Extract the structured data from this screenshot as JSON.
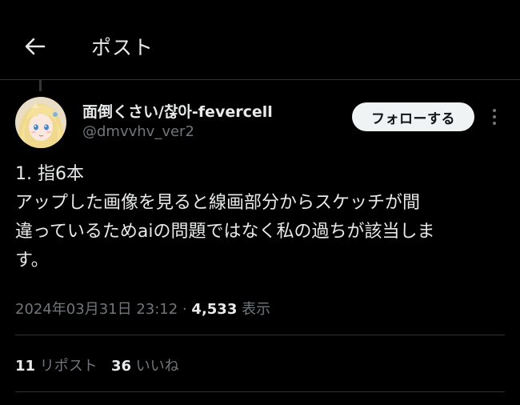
{
  "header": {
    "title": "ポスト",
    "back_icon": "arrow-left-icon"
  },
  "author": {
    "display_name": "面倒くさい/찮아-fevercell",
    "handle": "@dmvvhv_ver2",
    "avatar_icon": "avatar-anime-girl"
  },
  "follow_button": {
    "label": "フォローする"
  },
  "more_icon": "more-vertical-icon",
  "tweet": {
    "lines": [
      "1. 指6本",
      "アップした画像を見ると線画部分からスケッチが間",
      "違っているためaiの問題ではなく私の過ちが該当しま",
      "す。"
    ]
  },
  "meta": {
    "timestamp": "2024年03月31日 23:12",
    "separator": "·",
    "views_count": "4,533",
    "views_label": "表示"
  },
  "stats": {
    "reposts_count": "11",
    "reposts_label": "リポスト",
    "likes_count": "36",
    "likes_label": "いいね"
  },
  "colors": {
    "background": "#000000",
    "text_primary": "#e7e9ea",
    "text_secondary": "#71767b",
    "border": "#2f3336",
    "follow_bg": "#eff3f4"
  }
}
